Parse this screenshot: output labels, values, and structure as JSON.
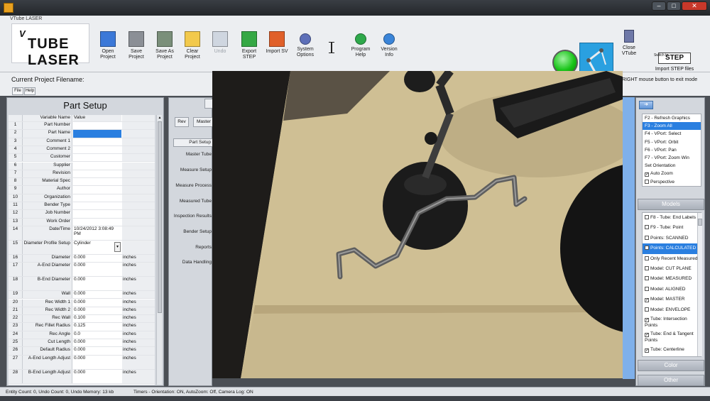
{
  "window": {
    "title": "VTube LASER",
    "buttons": [
      "–",
      "□",
      "✕"
    ]
  },
  "ribbon": {
    "logo_top": "V",
    "logo_main": "TUBE LASER",
    "items": [
      {
        "label": "Open\nProject",
        "icon": "open-project-icon",
        "enabled": true
      },
      {
        "label": "Save\nProject",
        "icon": "save-project-icon",
        "enabled": true
      },
      {
        "label": "Save As\nProject",
        "icon": "save-as-project-icon",
        "enabled": true
      },
      {
        "label": "Clear\nProject",
        "icon": "clear-project-icon",
        "enabled": true
      },
      {
        "label": "Undo",
        "icon": "undo-icon",
        "enabled": false
      },
      {
        "label": "Export\nSTEP",
        "icon": "export-step-icon",
        "enabled": true
      },
      {
        "label": "Import SV",
        "icon": "import-sv-icon",
        "enabled": true
      },
      {
        "label": "System\nOptions",
        "icon": "gear-icon",
        "enabled": true
      },
      {
        "label": "Program\nHelp",
        "icon": "help-icon",
        "enabled": true
      },
      {
        "label": "Version\nInfo",
        "icon": "info-icon",
        "enabled": true
      }
    ],
    "close_vtube": "Close\nVTube",
    "import_step_label": "Import STEP files",
    "step_badge": "STEP",
    "step_badge_top": "Switch to"
  },
  "filename_row": {
    "label": "Current Project Filename:",
    "right_message": "RIGHT mouse button to exit mode",
    "file_btn": "File",
    "help_btn": "Help"
  },
  "part_setup": {
    "title": "Part Setup",
    "col_name": "Variable Name",
    "col_value": "Value",
    "rows": [
      {
        "n": "1",
        "name": "Part Number",
        "value": "",
        "unit": ""
      },
      {
        "n": "2",
        "name": "Part Name",
        "value": "",
        "unit": "",
        "selected": true
      },
      {
        "n": "3",
        "name": "Comment 1",
        "value": "",
        "unit": ""
      },
      {
        "n": "4",
        "name": "Comment 2",
        "value": "",
        "unit": ""
      },
      {
        "n": "5",
        "name": "Customer",
        "value": "",
        "unit": ""
      },
      {
        "n": "6",
        "name": "Supplier",
        "value": "",
        "unit": ""
      },
      {
        "n": "7",
        "name": "Revision",
        "value": "",
        "unit": ""
      },
      {
        "n": "8",
        "name": "Material Spec",
        "value": "",
        "unit": ""
      },
      {
        "n": "9",
        "name": "Author",
        "value": "",
        "unit": ""
      },
      {
        "n": "10",
        "name": "Organization",
        "value": "",
        "unit": ""
      },
      {
        "n": "11",
        "name": "Bender Type",
        "value": "",
        "unit": ""
      },
      {
        "n": "12",
        "name": "Job Number",
        "value": "",
        "unit": ""
      },
      {
        "n": "13",
        "name": "Work Order",
        "value": "",
        "unit": ""
      },
      {
        "n": "14",
        "name": "Date/Time",
        "value": "10/24/2012 3:08:49 PM",
        "unit": "",
        "tall": true
      },
      {
        "n": "15",
        "name": "Diameter Profile Setup",
        "value": "Cylinder",
        "unit": "",
        "tall": true,
        "dropdown": true
      },
      {
        "n": "16",
        "name": "Diameter",
        "value": "0.000",
        "unit": "inches"
      },
      {
        "n": "17",
        "name": "A-End Diameter",
        "value": "0.000",
        "unit": "inches",
        "tall": true
      },
      {
        "n": "18",
        "name": "B-End Diameter",
        "value": "0.000",
        "unit": "inches",
        "tall": true
      },
      {
        "n": "19",
        "name": "Wall",
        "value": "0.000",
        "unit": "inches"
      },
      {
        "n": "20",
        "name": "Rec Width 1",
        "value": "0.000",
        "unit": "inches"
      },
      {
        "n": "21",
        "name": "Rec Width 2",
        "value": "0.000",
        "unit": "inches"
      },
      {
        "n": "22",
        "name": "Rec Wall",
        "value": "0.100",
        "unit": "inches"
      },
      {
        "n": "23",
        "name": "Rec Fillet Radius",
        "value": "0.125",
        "unit": "inches"
      },
      {
        "n": "24",
        "name": "Rec Angle",
        "value": "0.0",
        "unit": "inches"
      },
      {
        "n": "25",
        "name": "Cut Length",
        "value": "0.000",
        "unit": "inches"
      },
      {
        "n": "26",
        "name": "Default Radius",
        "value": "0.000",
        "unit": "inches"
      },
      {
        "n": "27",
        "name": "A-End Length Adjust",
        "value": "0.000",
        "unit": "inches",
        "tall": true
      },
      {
        "n": "28",
        "name": "B-End Length Adjust",
        "value": "0.000",
        "unit": "inches",
        "tall": true
      }
    ]
  },
  "middle": {
    "rev_btn": "Rev",
    "master_btn": "Master",
    "nav": [
      "Part Setup",
      "Master Tube",
      "Measure Setup",
      "Measure Process",
      "Measured Tube",
      "Inspection Results",
      "Bender Setup",
      "Reports",
      "Data Handling"
    ]
  },
  "right": {
    "view_items": [
      {
        "label": "F2 - Refresh Graphics"
      },
      {
        "label": "F3 - Zoom All",
        "selected": true
      },
      {
        "label": "F4 - VPort: Select"
      },
      {
        "label": "F5 - VPort: Orbit"
      },
      {
        "label": "F6 - VPort: Pan"
      },
      {
        "label": "F7 - VPort: Zoom Win"
      },
      {
        "label": "Set Orientation"
      },
      {
        "label": "Auto Zoom",
        "check": true,
        "checked": true
      },
      {
        "label": "Perspective",
        "check": true,
        "checked": false
      }
    ],
    "models_header": "Models",
    "model_items": [
      {
        "label": "F8 - Tube: End Labels",
        "checked": false
      },
      {
        "label": "F9 - Tube: Point",
        "checked": false
      },
      {
        "label": "Points: SCANNED",
        "checked": false
      },
      {
        "label": "Points: CALCULATED",
        "checked": false,
        "selected": true
      },
      {
        "label": "Only Recent Measured",
        "checked": false
      },
      {
        "label": "Model: CUT PLANE",
        "checked": false
      },
      {
        "label": "Model: MEASURED",
        "checked": false
      },
      {
        "label": "Model: ALIGNED",
        "checked": false
      },
      {
        "label": "Model: MASTER",
        "checked": true
      },
      {
        "label": "Model: ENVELOPE",
        "checked": false
      },
      {
        "label": "Tube: Intersection Points",
        "checked": true,
        "tall": true
      },
      {
        "label": "Tube: End & Tangent Points",
        "checked": true,
        "tall": true
      },
      {
        "label": "Tube: Centerline",
        "checked": true
      }
    ],
    "color_header": "Color",
    "other_header": "Other"
  },
  "status": {
    "left": "Entity Count: 0, Undo Count: 0, Undo Memory: 13 kb",
    "right": "Timers - Orientation: ON, AutoZoom: Off, Camera Log: ON"
  },
  "colors": {
    "accent": "#2a7fe0",
    "ribbon_bg": "#eceef1",
    "panel_bg": "#d3d7dd",
    "status_green": "#19c519"
  }
}
